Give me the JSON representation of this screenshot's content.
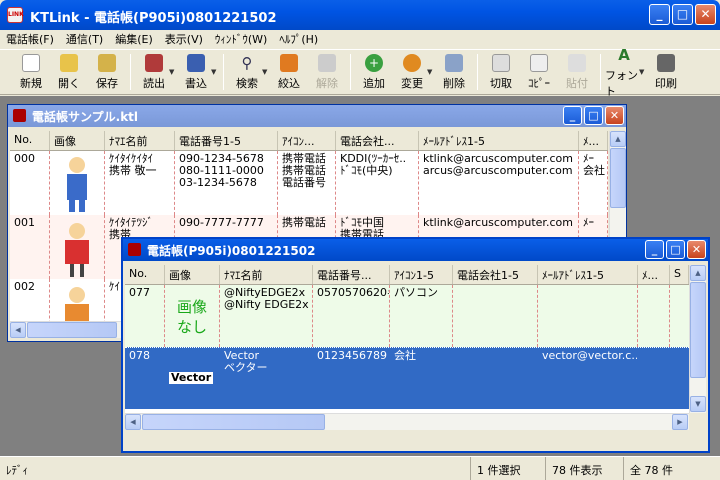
{
  "app": {
    "title": "KTLink - 電話帳(P905i)0801221502",
    "icon": "ktlink-app-icon",
    "icon_label": "LINK"
  },
  "menu": [
    "電話帳(F)",
    "通信(T)",
    "編集(E)",
    "表示(V)",
    "ｳｨﾝﾄﾞｳ(W)",
    "ﾍﾙﾌﾟ(H)"
  ],
  "toolbar": {
    "new": "新規",
    "open": "開く",
    "save": "保存",
    "read": "読出",
    "write": "書込",
    "search": "検索",
    "narrow": "絞込",
    "release": "解除",
    "add": "追加",
    "change": "変更",
    "delete": "削除",
    "cut": "切取",
    "copy": "ｺﾋﾟｰ",
    "paste": "貼付",
    "font": "フォント",
    "print": "印刷"
  },
  "back": {
    "title": "電話帳サンプル.ktl",
    "columns": [
      "No.",
      "画像",
      "ﾅﾏｴ名前",
      "電話番号1-5",
      "ｱｲｺﾝ...",
      "電話会社...",
      "ﾒｰﾙｱﾄﾞﾚｽ1-5",
      "ﾒ..."
    ],
    "rows": [
      {
        "no": "000",
        "kana": "ｹｲﾀｲｹｲﾀｲ",
        "name": "携帯 敬一",
        "tel": [
          "090-1234-5678",
          "080-1111-0000",
          "03-1234-5678"
        ],
        "icon": [
          "携帯電話",
          "携帯電話",
          "電話番号"
        ],
        "carrier": [
          "KDDI(ﾂｰｶｰｾ..",
          "ﾄﾞｺﾓ(中央)"
        ],
        "mail": [
          "ktlink@arcuscomputer.com",
          "arcus@arcuscomputer.com"
        ],
        "extra": [
          "ﾒｰ",
          "会社"
        ]
      },
      {
        "no": "001",
        "kana": "ｹｲﾀｲﾃﾂｼﾞ",
        "name": "携帯",
        "tel": [
          "090-7777-7777"
        ],
        "icon": [
          "携帯電話"
        ],
        "carrier": [
          "ﾄﾞｺﾓ中国",
          "携帯電話"
        ],
        "mail": [
          "ktlink@arcuscomputer.com"
        ],
        "extra": [
          "ﾒｰ"
        ]
      },
      {
        "no": "002",
        "kana": "ｹｲ"
      }
    ]
  },
  "front": {
    "title": "電話帳(P905i)0801221502",
    "columns": [
      "No.",
      "画像",
      "ﾅﾏｴ名前",
      "電話番号...",
      "ｱｲｺﾝ1-5",
      "電話会社1-5",
      "ﾒｰﾙｱﾄﾞﾚｽ1-5",
      "ﾒ...",
      "S"
    ],
    "rows": [
      {
        "no": "077",
        "image_text": "画像\nなし",
        "name1": "@NiftyEDGE2x",
        "name2": "@Nifty EDGE2x",
        "tel": "0570570620#...",
        "icon": "パソコン",
        "mail": ""
      },
      {
        "no": "078",
        "logo": "Vector",
        "name1": "Vector",
        "name2": "ベクター",
        "tel": "0123456789",
        "icon": "会社",
        "mail": "vector@vector.c..."
      }
    ]
  },
  "status": {
    "ready": "ﾚﾃﾞｨ",
    "selected": "1 件選択",
    "shown": "78 件表示",
    "total": "全 78 件"
  },
  "colors": {
    "title_blue": "#0054e3",
    "selected_row": "#316ac5",
    "green_row": "#eefbe8",
    "noimg_green": "#1aa81a"
  }
}
